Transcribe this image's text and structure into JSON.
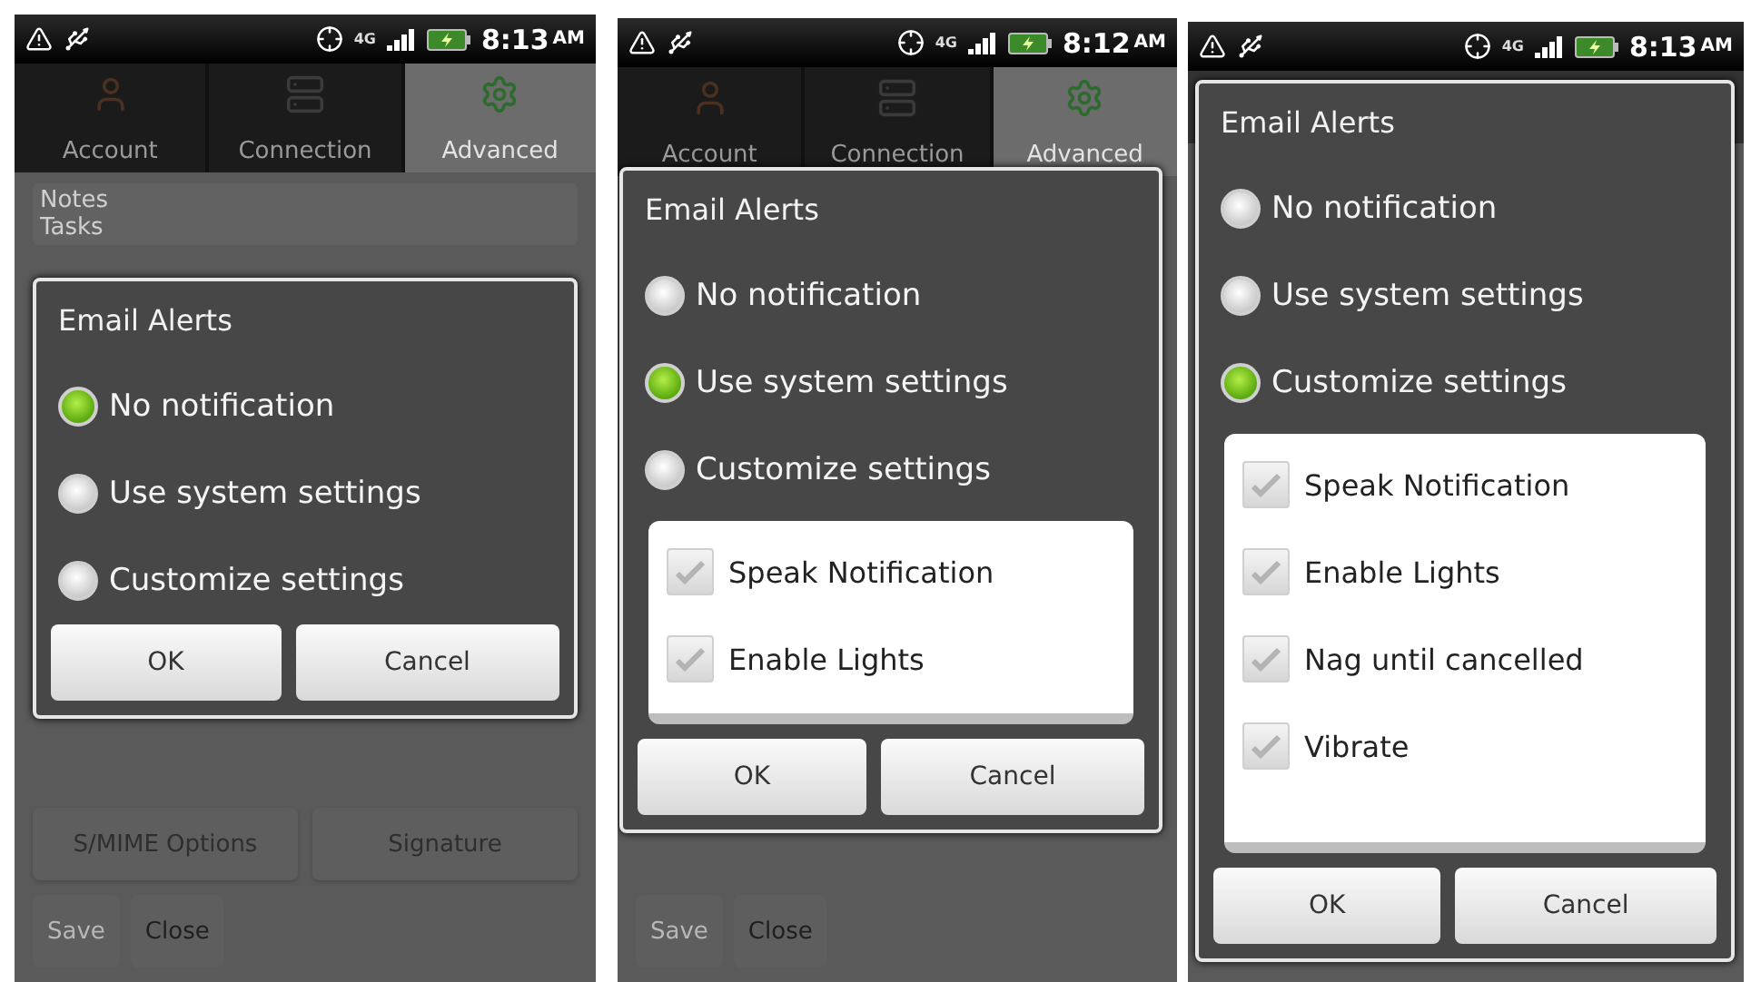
{
  "phones": [
    {
      "status": {
        "network": "4G",
        "time": "8:13",
        "ampm": "AM"
      },
      "tabs": [
        {
          "label": "Account",
          "selected": false
        },
        {
          "label": "Connection",
          "selected": false
        },
        {
          "label": "Advanced",
          "selected": true
        }
      ],
      "field": {
        "lines": [
          "Notes",
          "Tasks"
        ]
      },
      "buttons": [
        [
          "S/MIME Options",
          "Signature"
        ]
      ],
      "actions": [
        {
          "label": "Save",
          "disabled": true
        },
        {
          "label": "Close",
          "disabled": false
        }
      ],
      "dialog": {
        "title": "Email Alerts",
        "options": [
          {
            "label": "No notification",
            "selected": true
          },
          {
            "label": "Use system settings",
            "selected": false
          },
          {
            "label": "Customize settings",
            "selected": false
          }
        ],
        "buttons": [
          "OK",
          "Cancel"
        ]
      }
    },
    {
      "status": {
        "network": "4G",
        "time": "8:12",
        "ampm": "AM"
      },
      "tabs": [
        {
          "label": "Account",
          "selected": false
        },
        {
          "label": "Connection",
          "selected": false
        },
        {
          "label": "Advanced",
          "selected": true
        }
      ],
      "actions": [
        {
          "label": "Save",
          "disabled": true
        },
        {
          "label": "Close",
          "disabled": false
        }
      ],
      "dialog": {
        "title": "Email Alerts",
        "options": [
          {
            "label": "No notification",
            "selected": false
          },
          {
            "label": "Use system settings",
            "selected": true
          },
          {
            "label": "Customize settings",
            "selected": false
          }
        ],
        "checkboxes": [
          {
            "label": "Speak Notification",
            "checked": false
          },
          {
            "label": "Enable Lights",
            "checked": false
          }
        ],
        "buttons": [
          "OK",
          "Cancel"
        ]
      }
    },
    {
      "status": {
        "network": "4G",
        "time": "8:13",
        "ampm": "AM"
      },
      "dialog": {
        "title": "Email Alerts",
        "options": [
          {
            "label": "No notification",
            "selected": false
          },
          {
            "label": "Use system settings",
            "selected": false
          },
          {
            "label": "Customize settings",
            "selected": true
          }
        ],
        "checkboxes": [
          {
            "label": "Speak Notification",
            "checked": false
          },
          {
            "label": "Enable Lights",
            "checked": false
          },
          {
            "label": "Nag until cancelled",
            "checked": false
          },
          {
            "label": "Vibrate",
            "checked": false
          }
        ],
        "buttons": [
          "OK",
          "Cancel"
        ]
      }
    }
  ]
}
